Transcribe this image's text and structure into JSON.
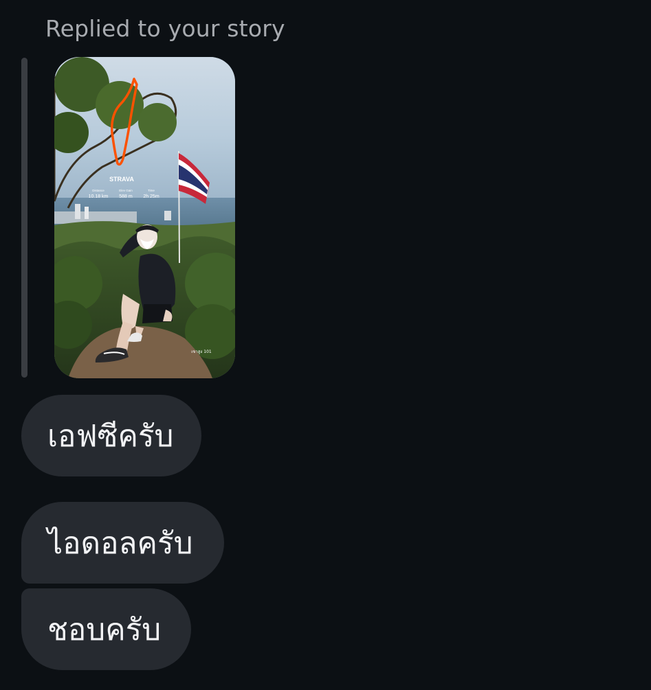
{
  "thread": {
    "reply_label": "Replied to your story"
  },
  "story": {
    "overlay_brand": "STRAVA",
    "stats": [
      {
        "label": "Distance",
        "value": "10.18 km"
      },
      {
        "label": "Elev Gain",
        "value": "588 m"
      },
      {
        "label": "Time",
        "value": "2h 25m"
      }
    ],
    "location_tag": "เขาสูง 101",
    "accent_color": "#fc5200"
  },
  "messages": [
    {
      "text": "เอฟซีครับ"
    },
    {
      "text": "ไอดอลครับ"
    },
    {
      "text": "ชอบครับ"
    }
  ]
}
